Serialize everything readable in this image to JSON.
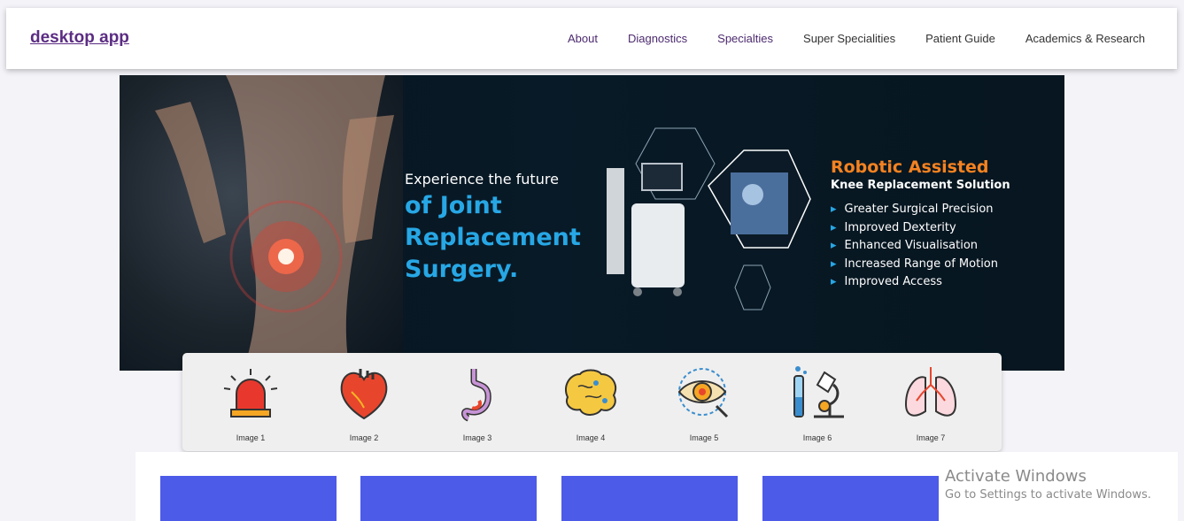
{
  "navbar": {
    "brand": "desktop app",
    "links": [
      "About",
      "Diagnostics",
      "Specialties",
      "Super Specialities",
      "Patient Guide",
      "Academics & Research"
    ]
  },
  "hero": {
    "intro": "Experience the future",
    "headline": [
      "of Joint",
      "Replacement",
      "Surgery."
    ],
    "robotic_title": "Robotic Assisted",
    "robotic_subtitle": "Knee Replacement Solution",
    "features": [
      "Greater Surgical Precision",
      "Improved Dexterity",
      "Enhanced Visualisation",
      "Increased Range of Motion",
      "Improved Access"
    ]
  },
  "icons": [
    {
      "icon": "alarm-siren-icon",
      "caption": "Image 1"
    },
    {
      "icon": "heart-icon",
      "caption": "Image 2"
    },
    {
      "icon": "stomach-icon",
      "caption": "Image 3"
    },
    {
      "icon": "brain-icon",
      "caption": "Image 4"
    },
    {
      "icon": "eye-icon",
      "caption": "Image 5"
    },
    {
      "icon": "microscope-icon",
      "caption": "Image 6"
    },
    {
      "icon": "lungs-icon",
      "caption": "Image 7"
    }
  ],
  "watermark": {
    "title": "Activate Windows",
    "subtitle": "Go to Settings to activate Windows."
  },
  "colors": {
    "accent": "#27a7e5",
    "orange": "#f58220",
    "card": "#4c5be8",
    "brand": "#5b2c83"
  }
}
